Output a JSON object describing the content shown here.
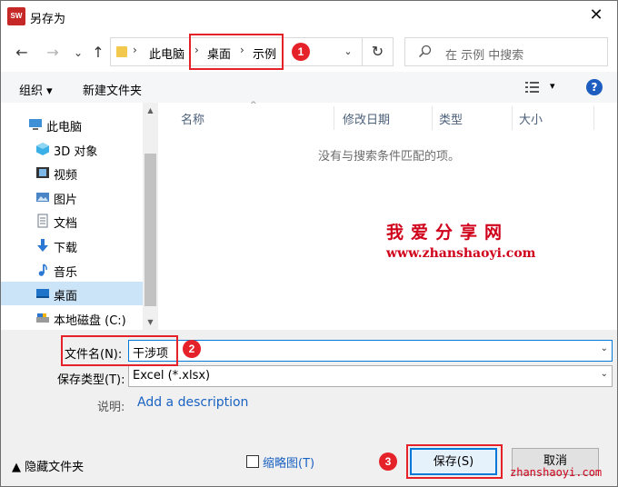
{
  "titlebar": {
    "app_icon_text": "SW\n2018",
    "title": "另存为",
    "close_glyph": "✕"
  },
  "nav": {
    "back": "←",
    "forward": "→",
    "recent": "⌄",
    "up": "↑",
    "breadcrumb": [
      "此电脑",
      "桌面",
      "示例"
    ],
    "dropdown": "⌄",
    "refresh": "↻",
    "search_placeholder": "在 示例 中搜索"
  },
  "toolbar": {
    "organize": "组织 ▾",
    "new_folder": "新建文件夹",
    "view_caret": "▾",
    "help": "?"
  },
  "tree": {
    "items": [
      {
        "label": "此电脑",
        "icon": "computer-icon"
      },
      {
        "label": "3D 对象",
        "icon": "cube-icon"
      },
      {
        "label": "视频",
        "icon": "video-icon"
      },
      {
        "label": "图片",
        "icon": "picture-icon"
      },
      {
        "label": "文档",
        "icon": "document-icon"
      },
      {
        "label": "下载",
        "icon": "download-icon"
      },
      {
        "label": "音乐",
        "icon": "music-icon"
      },
      {
        "label": "桌面",
        "icon": "desktop-icon",
        "selected": true
      },
      {
        "label": "本地磁盘 (C:)",
        "icon": "drive-icon"
      }
    ]
  },
  "filelist": {
    "columns": [
      "名称",
      "修改日期",
      "类型",
      "大小"
    ],
    "empty_message": "没有与搜索条件匹配的项。"
  },
  "watermark": {
    "title": "我爱分享网",
    "url": "www.zhanshaoyi.com",
    "bottom_url": "zhanshaoyi.com"
  },
  "form": {
    "filename_label": "文件名(N):",
    "filename_value": "干涉项",
    "filetype_label": "保存类型(T):",
    "filetype_value": "Excel (*.xlsx)",
    "description_label": "说明:",
    "description_link": "Add a description"
  },
  "footer": {
    "hide_folders": "▲ 隐藏文件夹",
    "thumbnail_label": "缩略图(T)",
    "save_label": "保存(S)",
    "cancel_label": "取消"
  },
  "annotations": [
    "1",
    "2",
    "3"
  ],
  "colors": {
    "annotation": "#e5222a",
    "link": "#1a62c2",
    "accent": "#0078d7"
  }
}
